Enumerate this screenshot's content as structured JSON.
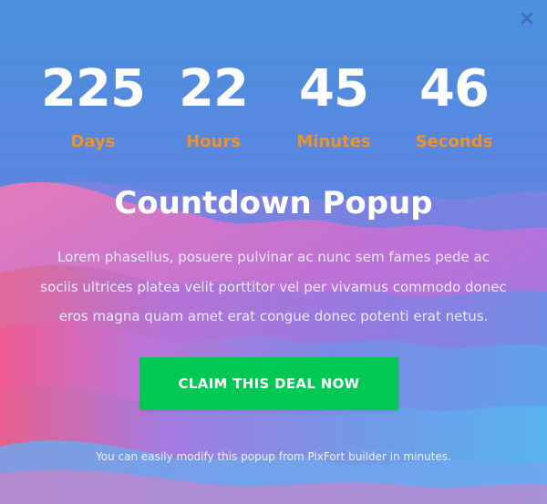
{
  "popup": {
    "close_icon": "close-icon",
    "countdown": [
      {
        "value": "225",
        "label": "Days"
      },
      {
        "value": "22",
        "label": "Hours"
      },
      {
        "value": "45",
        "label": "Minutes"
      },
      {
        "value": "46",
        "label": "Seconds"
      }
    ],
    "title": "Countdown Popup",
    "body": "Lorem phasellus, posuere pulvinar ac nunc sem fames pede ac sociis ultrices platea velit porttitor vel per vivamus commodo donec eros magna quam amet erat congue donec potenti erat netus.",
    "cta_label": "CLAIM THIS DEAL NOW",
    "footer": "You can easily modify this popup from PixFort builder in minutes."
  },
  "colors": {
    "accent_label": "#f0922b",
    "cta_background": "#00c853",
    "text_primary": "#ffffff"
  }
}
